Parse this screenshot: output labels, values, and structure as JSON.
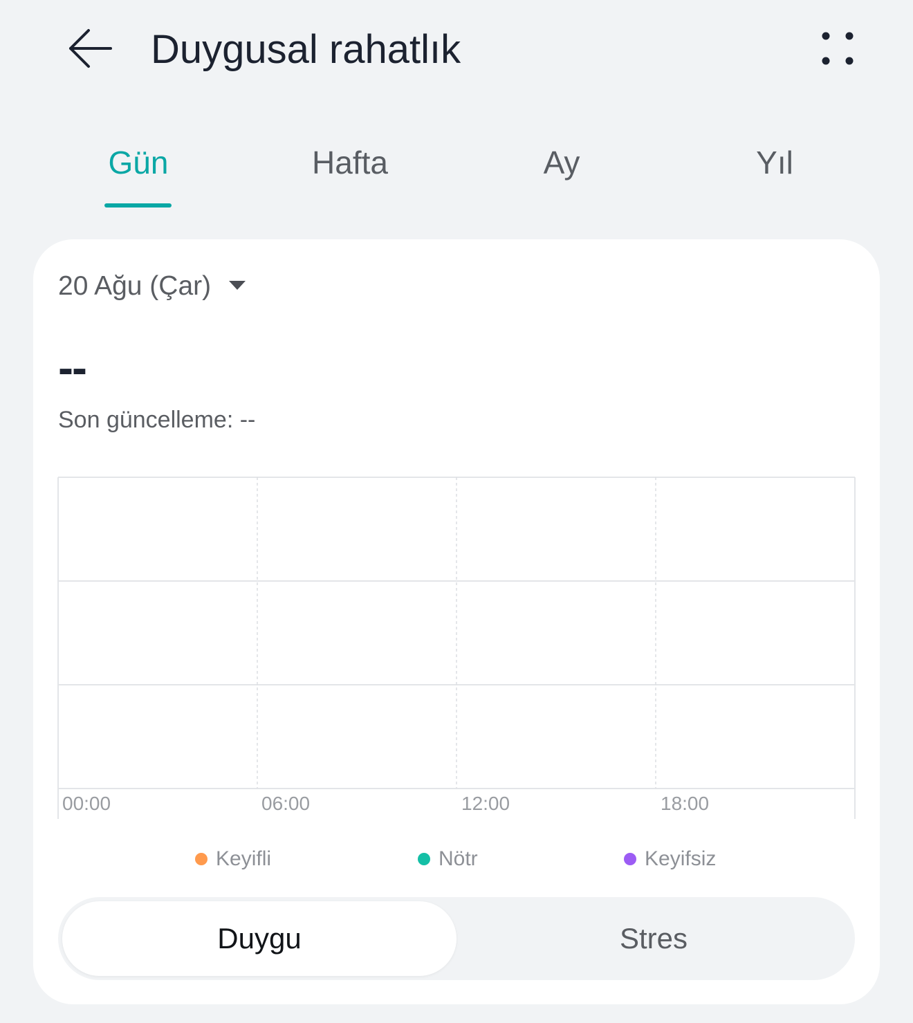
{
  "header": {
    "title": "Duygusal rahatlık",
    "back_icon": "arrow-left-icon",
    "more_icon": "more-dots-icon"
  },
  "tabs": [
    {
      "label": "Gün",
      "active": true
    },
    {
      "label": "Hafta",
      "active": false
    },
    {
      "label": "Ay",
      "active": false
    },
    {
      "label": "Yıl",
      "active": false
    }
  ],
  "card": {
    "date": "20 Ağu (Çar)",
    "value": "--",
    "last_update": "Son güncelleme: --"
  },
  "colors": {
    "accent": "#0aa7a5",
    "keyifli": "#ff9a4d",
    "notr": "#14bfa6",
    "keyifsiz": "#9c5cf4"
  },
  "chart_data": {
    "type": "line",
    "x_ticks": [
      "00:00",
      "06:00",
      "12:00",
      "18:00"
    ],
    "series": [],
    "legend": [
      {
        "name": "Keyifli",
        "color": "#ff9a4d"
      },
      {
        "name": "Nötr",
        "color": "#14bfa6"
      },
      {
        "name": "Keyifsiz",
        "color": "#9c5cf4"
      }
    ],
    "grid": true
  },
  "segment": {
    "options": [
      "Duygu",
      "Stres"
    ],
    "selected": "Duygu"
  }
}
